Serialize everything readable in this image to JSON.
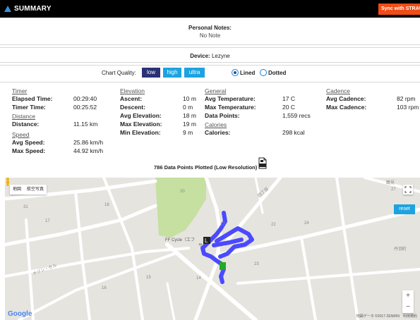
{
  "header": {
    "title": "SUMMARY",
    "sync_label": "Sync with STRAVA"
  },
  "notes": {
    "label": "Personal Notes:",
    "value": "No Note"
  },
  "device": {
    "label": "Device:",
    "value": "Lezyne"
  },
  "chart_quality": {
    "label": "Chart Quality:",
    "options": [
      "low",
      "high",
      "ultra"
    ],
    "selected": "low",
    "line_styles": [
      "Lined",
      "Dotted"
    ],
    "selected_line_style": "Lined"
  },
  "stats": {
    "timer": {
      "title": "Timer",
      "rows": [
        {
          "k": "Elapsed Time:",
          "v": "00:29:40"
        },
        {
          "k": "Timer Time:",
          "v": "00:25:52"
        }
      ]
    },
    "distance": {
      "title": "Distance",
      "rows": [
        {
          "k": "Distance:",
          "v": "11.15 km"
        }
      ]
    },
    "speed": {
      "title": "Speed",
      "rows": [
        {
          "k": "Avg Speed:",
          "v": "25.86 km/h"
        },
        {
          "k": "Max Speed:",
          "v": "44.92 km/h"
        }
      ]
    },
    "elevation": {
      "title": "Elevation",
      "rows": [
        {
          "k": "Ascent:",
          "v": "10 m"
        },
        {
          "k": "Descent:",
          "v": "0 m"
        },
        {
          "k": "Avg Elevation:",
          "v": "18 m"
        },
        {
          "k": "Max Elevation:",
          "v": "19 m"
        },
        {
          "k": "Min Elevation:",
          "v": "9 m"
        }
      ]
    },
    "general": {
      "title": "General",
      "rows": [
        {
          "k": "Avg Temperature:",
          "v": "17 C"
        },
        {
          "k": "Max Temperature:",
          "v": "20 C"
        },
        {
          "k": "Data Points:",
          "v": "1,559 recs"
        }
      ]
    },
    "calories": {
      "title": "Calories",
      "rows": [
        {
          "k": "Calories:",
          "v": "298 kcal"
        }
      ]
    },
    "cadence": {
      "title": "Cadence",
      "rows": [
        {
          "k": "Avg Cadence:",
          "v": "82 rpm"
        },
        {
          "k": "Max Cadence:",
          "v": "103 rpm"
        }
      ]
    }
  },
  "plotted_label": "786 Data Points Plotted (Low Resolution)",
  "map": {
    "type_options": [
      "地図",
      "航空写真"
    ],
    "reset_label": "reset",
    "zoom_in": "+",
    "zoom_out": "−",
    "google_label": "Google",
    "attribution": "地図データ ©2017 ZENRIN　利用規約",
    "labels": [
      "31",
      "17",
      "18",
      "20",
      "17",
      "22",
      "24",
      "27",
      "23",
      "15",
      "14",
      "16",
      "FF Cycle（エフ",
      "サイ",
      "メゾン・セル",
      "鶴見",
      "四丁目",
      "丹羽町"
    ],
    "track_color": "#4a4aff",
    "end_marker_color": "#22aa22",
    "park_color": "#c5e0a0"
  },
  "colors": {
    "quality_low": "#2a3275",
    "quality_other": "#1ca3e0",
    "sync_button": "#f04c16"
  }
}
